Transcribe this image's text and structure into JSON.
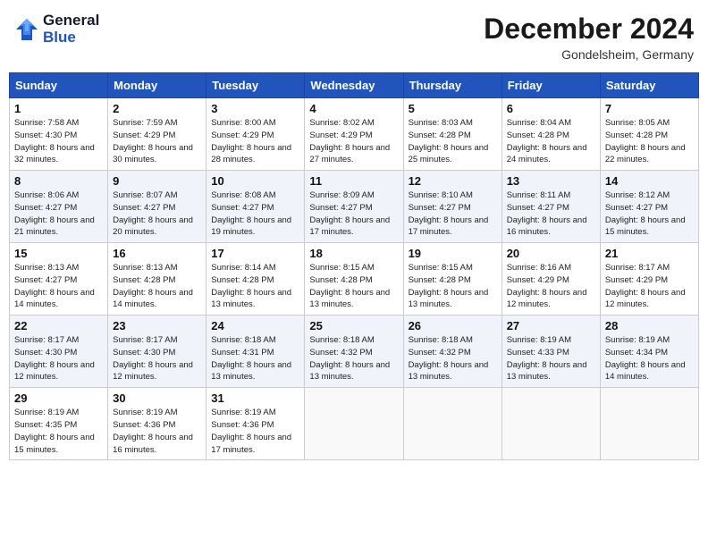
{
  "header": {
    "logo_line1": "General",
    "logo_line2": "Blue",
    "month_title": "December 2024",
    "subtitle": "Gondelsheim, Germany"
  },
  "weekdays": [
    "Sunday",
    "Monday",
    "Tuesday",
    "Wednesday",
    "Thursday",
    "Friday",
    "Saturday"
  ],
  "weeks": [
    [
      {
        "day": "1",
        "sunrise": "Sunrise: 7:58 AM",
        "sunset": "Sunset: 4:30 PM",
        "daylight": "Daylight: 8 hours and 32 minutes."
      },
      {
        "day": "2",
        "sunrise": "Sunrise: 7:59 AM",
        "sunset": "Sunset: 4:29 PM",
        "daylight": "Daylight: 8 hours and 30 minutes."
      },
      {
        "day": "3",
        "sunrise": "Sunrise: 8:00 AM",
        "sunset": "Sunset: 4:29 PM",
        "daylight": "Daylight: 8 hours and 28 minutes."
      },
      {
        "day": "4",
        "sunrise": "Sunrise: 8:02 AM",
        "sunset": "Sunset: 4:29 PM",
        "daylight": "Daylight: 8 hours and 27 minutes."
      },
      {
        "day": "5",
        "sunrise": "Sunrise: 8:03 AM",
        "sunset": "Sunset: 4:28 PM",
        "daylight": "Daylight: 8 hours and 25 minutes."
      },
      {
        "day": "6",
        "sunrise": "Sunrise: 8:04 AM",
        "sunset": "Sunset: 4:28 PM",
        "daylight": "Daylight: 8 hours and 24 minutes."
      },
      {
        "day": "7",
        "sunrise": "Sunrise: 8:05 AM",
        "sunset": "Sunset: 4:28 PM",
        "daylight": "Daylight: 8 hours and 22 minutes."
      }
    ],
    [
      {
        "day": "8",
        "sunrise": "Sunrise: 8:06 AM",
        "sunset": "Sunset: 4:27 PM",
        "daylight": "Daylight: 8 hours and 21 minutes."
      },
      {
        "day": "9",
        "sunrise": "Sunrise: 8:07 AM",
        "sunset": "Sunset: 4:27 PM",
        "daylight": "Daylight: 8 hours and 20 minutes."
      },
      {
        "day": "10",
        "sunrise": "Sunrise: 8:08 AM",
        "sunset": "Sunset: 4:27 PM",
        "daylight": "Daylight: 8 hours and 19 minutes."
      },
      {
        "day": "11",
        "sunrise": "Sunrise: 8:09 AM",
        "sunset": "Sunset: 4:27 PM",
        "daylight": "Daylight: 8 hours and 17 minutes."
      },
      {
        "day": "12",
        "sunrise": "Sunrise: 8:10 AM",
        "sunset": "Sunset: 4:27 PM",
        "daylight": "Daylight: 8 hours and 17 minutes."
      },
      {
        "day": "13",
        "sunrise": "Sunrise: 8:11 AM",
        "sunset": "Sunset: 4:27 PM",
        "daylight": "Daylight: 8 hours and 16 minutes."
      },
      {
        "day": "14",
        "sunrise": "Sunrise: 8:12 AM",
        "sunset": "Sunset: 4:27 PM",
        "daylight": "Daylight: 8 hours and 15 minutes."
      }
    ],
    [
      {
        "day": "15",
        "sunrise": "Sunrise: 8:13 AM",
        "sunset": "Sunset: 4:27 PM",
        "daylight": "Daylight: 8 hours and 14 minutes."
      },
      {
        "day": "16",
        "sunrise": "Sunrise: 8:13 AM",
        "sunset": "Sunset: 4:28 PM",
        "daylight": "Daylight: 8 hours and 14 minutes."
      },
      {
        "day": "17",
        "sunrise": "Sunrise: 8:14 AM",
        "sunset": "Sunset: 4:28 PM",
        "daylight": "Daylight: 8 hours and 13 minutes."
      },
      {
        "day": "18",
        "sunrise": "Sunrise: 8:15 AM",
        "sunset": "Sunset: 4:28 PM",
        "daylight": "Daylight: 8 hours and 13 minutes."
      },
      {
        "day": "19",
        "sunrise": "Sunrise: 8:15 AM",
        "sunset": "Sunset: 4:28 PM",
        "daylight": "Daylight: 8 hours and 13 minutes."
      },
      {
        "day": "20",
        "sunrise": "Sunrise: 8:16 AM",
        "sunset": "Sunset: 4:29 PM",
        "daylight": "Daylight: 8 hours and 12 minutes."
      },
      {
        "day": "21",
        "sunrise": "Sunrise: 8:17 AM",
        "sunset": "Sunset: 4:29 PM",
        "daylight": "Daylight: 8 hours and 12 minutes."
      }
    ],
    [
      {
        "day": "22",
        "sunrise": "Sunrise: 8:17 AM",
        "sunset": "Sunset: 4:30 PM",
        "daylight": "Daylight: 8 hours and 12 minutes."
      },
      {
        "day": "23",
        "sunrise": "Sunrise: 8:17 AM",
        "sunset": "Sunset: 4:30 PM",
        "daylight": "Daylight: 8 hours and 12 minutes."
      },
      {
        "day": "24",
        "sunrise": "Sunrise: 8:18 AM",
        "sunset": "Sunset: 4:31 PM",
        "daylight": "Daylight: 8 hours and 13 minutes."
      },
      {
        "day": "25",
        "sunrise": "Sunrise: 8:18 AM",
        "sunset": "Sunset: 4:32 PM",
        "daylight": "Daylight: 8 hours and 13 minutes."
      },
      {
        "day": "26",
        "sunrise": "Sunrise: 8:18 AM",
        "sunset": "Sunset: 4:32 PM",
        "daylight": "Daylight: 8 hours and 13 minutes."
      },
      {
        "day": "27",
        "sunrise": "Sunrise: 8:19 AM",
        "sunset": "Sunset: 4:33 PM",
        "daylight": "Daylight: 8 hours and 13 minutes."
      },
      {
        "day": "28",
        "sunrise": "Sunrise: 8:19 AM",
        "sunset": "Sunset: 4:34 PM",
        "daylight": "Daylight: 8 hours and 14 minutes."
      }
    ],
    [
      {
        "day": "29",
        "sunrise": "Sunrise: 8:19 AM",
        "sunset": "Sunset: 4:35 PM",
        "daylight": "Daylight: 8 hours and 15 minutes."
      },
      {
        "day": "30",
        "sunrise": "Sunrise: 8:19 AM",
        "sunset": "Sunset: 4:36 PM",
        "daylight": "Daylight: 8 hours and 16 minutes."
      },
      {
        "day": "31",
        "sunrise": "Sunrise: 8:19 AM",
        "sunset": "Sunset: 4:36 PM",
        "daylight": "Daylight: 8 hours and 17 minutes."
      },
      null,
      null,
      null,
      null
    ]
  ]
}
